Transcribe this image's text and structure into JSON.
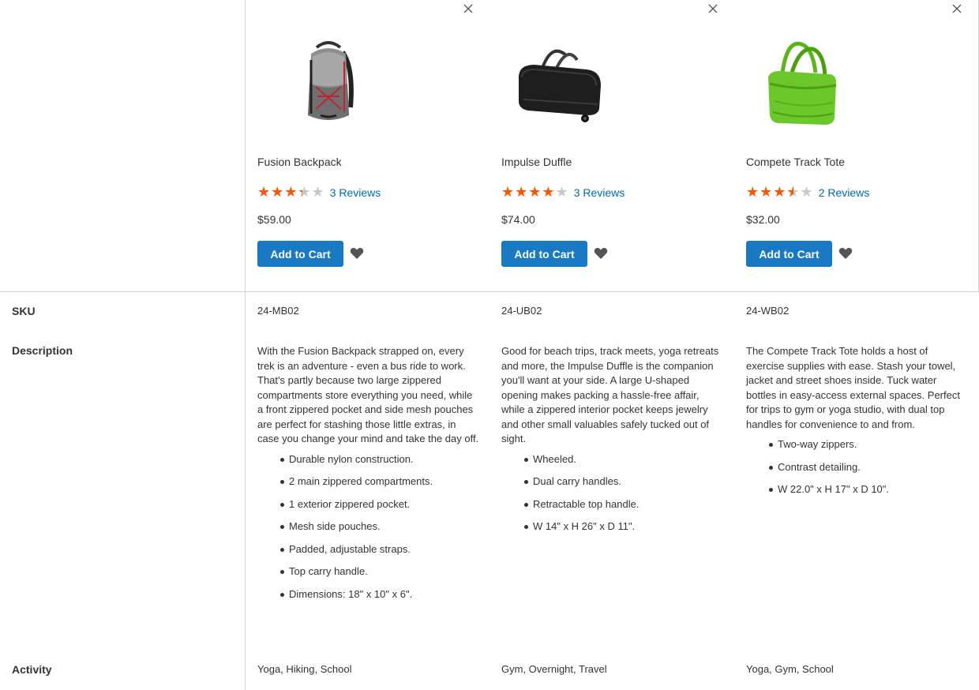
{
  "labels": {
    "sku": "SKU",
    "description": "Description",
    "activity": "Activity"
  },
  "colors": {
    "accent": "#1979c3",
    "link": "#006bb4",
    "star_filled": "#ff5501",
    "star_empty": "#c7c7c7"
  },
  "products": [
    {
      "name": "Fusion Backpack",
      "image_icon": "backpack-image",
      "rating_percent": 67,
      "rating_stars": "★★★★★",
      "reviews": "3 Reviews",
      "price": "$59.00",
      "add_to_cart": "Add to Cart",
      "sku": "24-MB02",
      "description": "With the Fusion Backpack strapped on, every trek is an adventure - even a bus ride to work. That's partly because two large zippered compartments store everything you need, while a front zippered pocket and side mesh pouches are perfect for stashing those little extras, in case you change your mind and take the day off.",
      "features": [
        "Durable nylon construction.",
        "2 main zippered compartments.",
        "1 exterior zippered pocket.",
        "Mesh side pouches.",
        "Padded, adjustable straps.",
        "Top carry handle.",
        "Dimensions: 18\" x 10\" x 6\"."
      ],
      "activity": "Yoga, Hiking, School"
    },
    {
      "name": "Impulse Duffle",
      "image_icon": "duffle-bag-image",
      "rating_percent": 80,
      "rating_stars": "★★★★★",
      "reviews": "3 Reviews",
      "price": "$74.00",
      "add_to_cart": "Add to Cart",
      "sku": "24-UB02",
      "description": "Good for beach trips, track meets, yoga retreats and more, the Impulse Duffle is the companion you'll want at your side. A large U-shaped opening makes packing a hassle-free affair, while a zippered interior pocket keeps jewelry and other small valuables safely tucked out of sight.",
      "features": [
        "Wheeled.",
        "Dual carry handles.",
        "Retractable top handle.",
        "W 14\" x H 26\" x D 11\"."
      ],
      "activity": "Gym, Overnight, Travel"
    },
    {
      "name": "Compete Track Tote",
      "image_icon": "tote-bag-image",
      "rating_percent": 70,
      "rating_stars": "★★★★★",
      "reviews": "2 Reviews",
      "price": "$32.00",
      "add_to_cart": "Add to Cart",
      "sku": "24-WB02",
      "description": "The Compete Track Tote holds a host of exercise supplies with ease. Stash your towel, jacket and street shoes inside. Tuck water bottles in easy-access external spaces. Perfect for trips to gym or yoga studio, with dual top handles for convenience to and from.",
      "features": [
        "Two-way zippers.",
        "Contrast detailing.",
        "W 22.0\" x H 17\" x D 10\"."
      ],
      "activity": "Yoga, Gym, School"
    }
  ]
}
